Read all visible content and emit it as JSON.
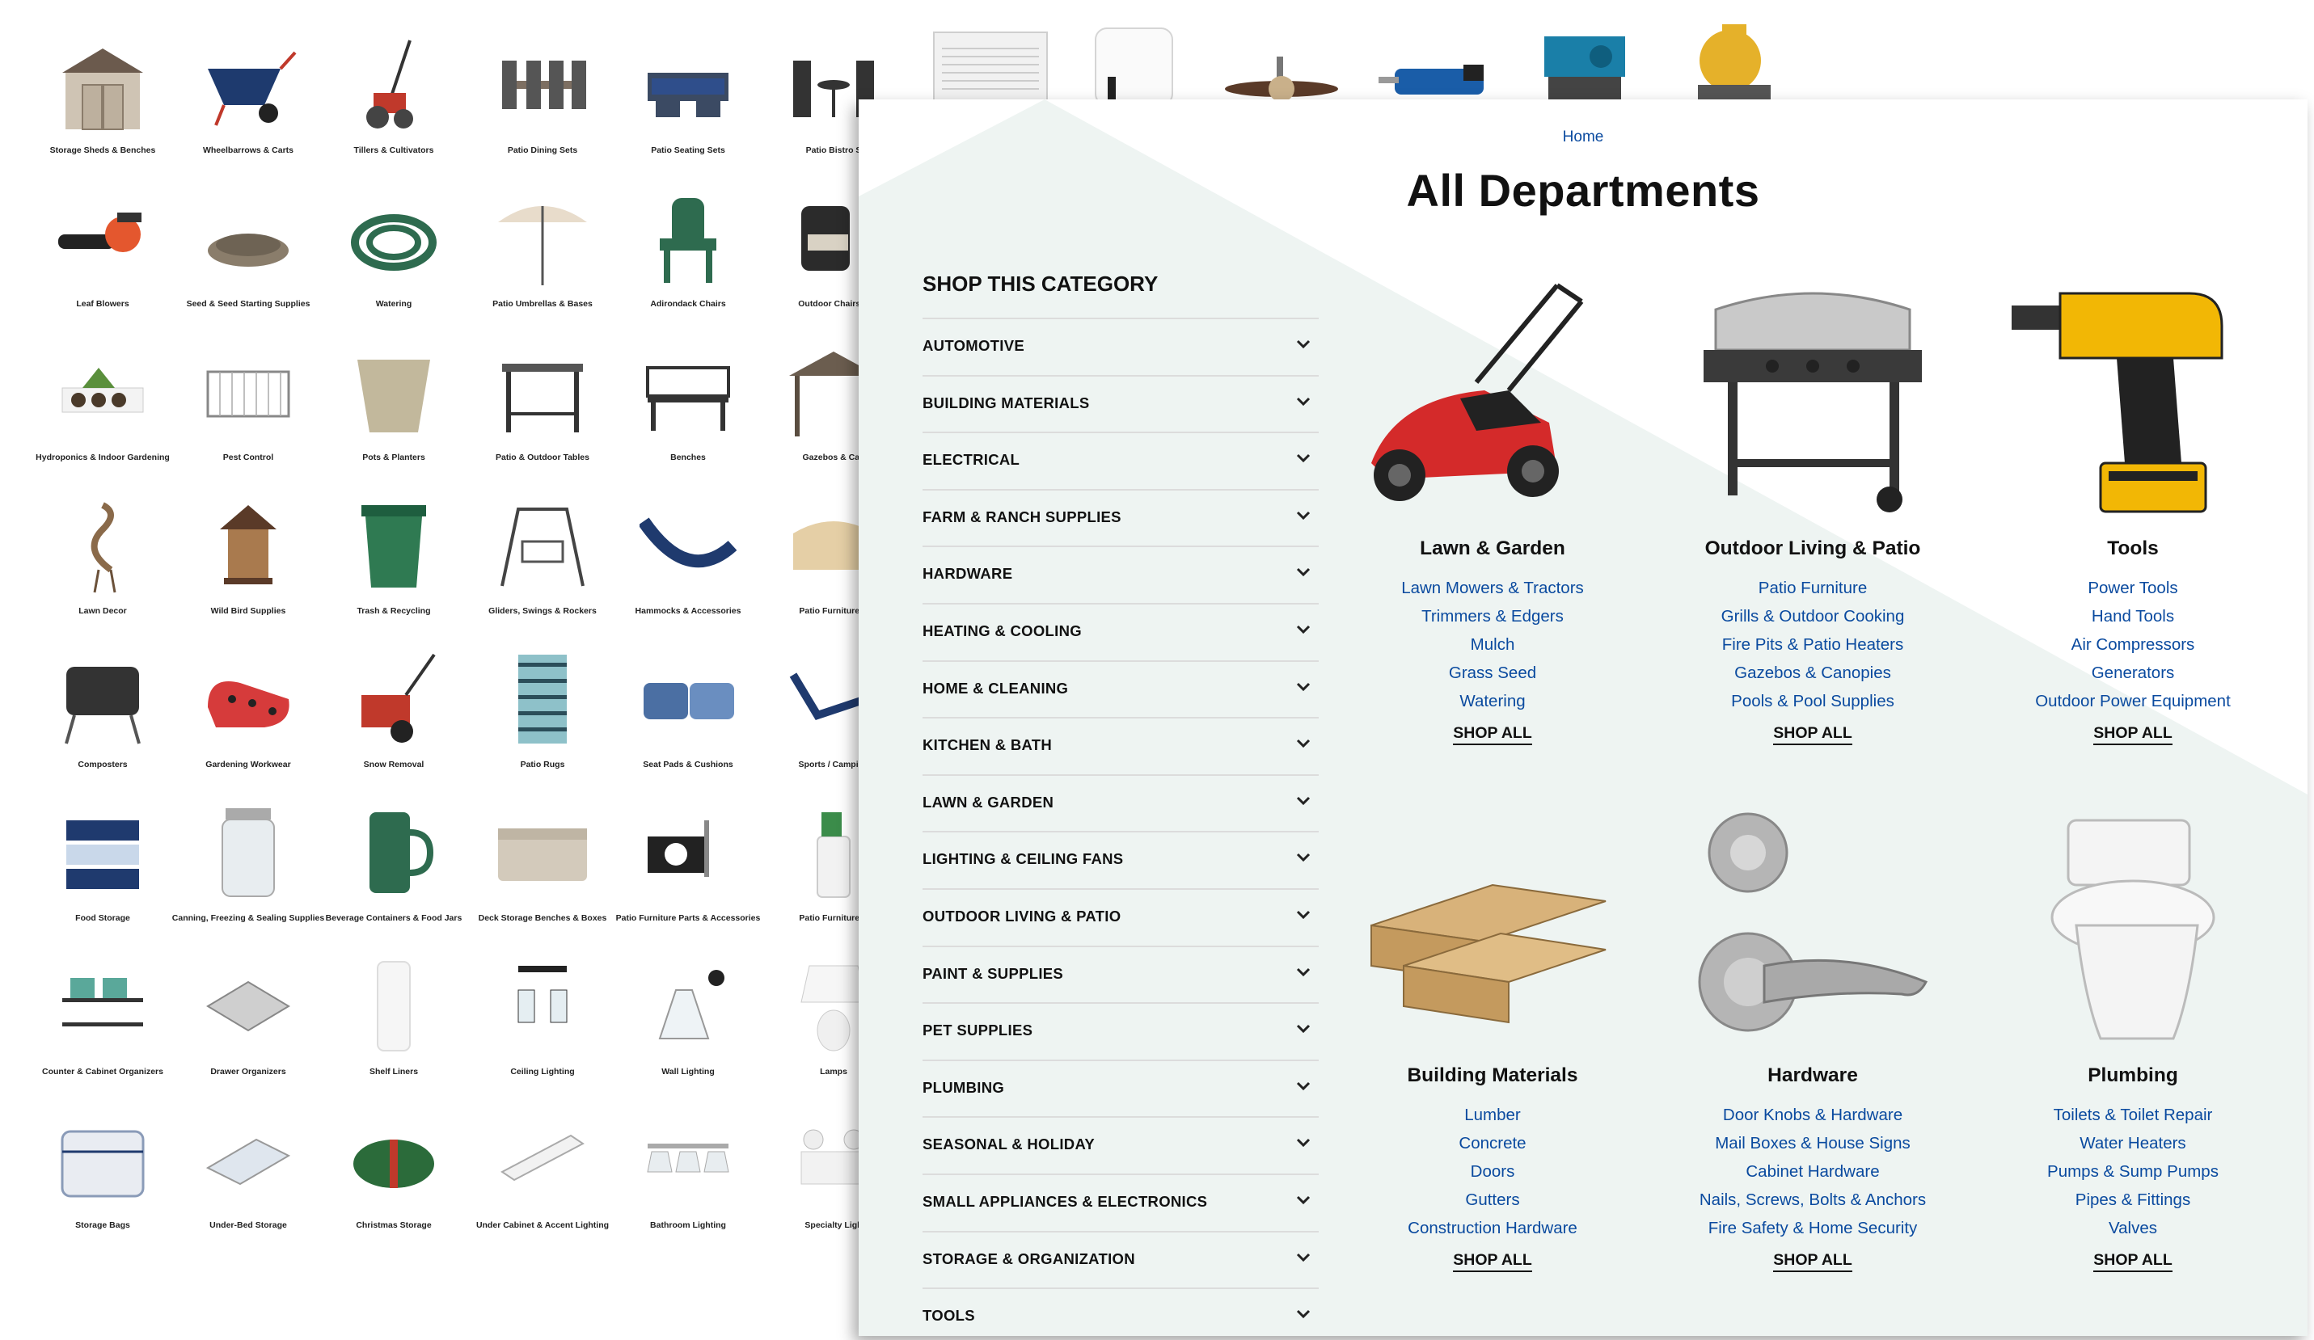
{
  "background": {
    "top_row_visible": [
      "air-conditioner",
      "air-purifier",
      "ceiling-fan",
      "reciprocating-saw",
      "jigsaw",
      "miter-saw"
    ],
    "grid": [
      [
        "Storage Sheds & Benches",
        "Wheelbarrows & Carts",
        "Tillers & Cultivators",
        "Patio Dining Sets",
        "Patio Seating Sets",
        "Patio Bistro S"
      ],
      [
        "Leaf Blowers",
        "Seed & Seed Starting Supplies",
        "Watering",
        "Patio Umbrellas & Bases",
        "Adirondack Chairs",
        "Outdoor Chairs &"
      ],
      [
        "Hydroponics & Indoor Gardening",
        "Pest Control",
        "Pots & Planters",
        "Patio & Outdoor Tables",
        "Benches",
        "Gazebos & Can"
      ],
      [
        "Lawn Decor",
        "Wild Bird Supplies",
        "Trash & Recycling",
        "Gliders, Swings & Rockers",
        "Hammocks & Accessories",
        "Patio Furniture C"
      ],
      [
        "Composters",
        "Gardening Workwear",
        "Snow Removal",
        "Patio Rugs",
        "Seat Pads & Cushions",
        "Sports / Camping"
      ],
      [
        "Food Storage",
        "Canning, Freezing & Sealing Supplies",
        "Beverage Containers & Food Jars",
        "Deck Storage Benches & Boxes",
        "Patio Furniture Parts & Accessories",
        "Patio Furniture C"
      ],
      [
        "Counter & Cabinet Organizers",
        "Drawer Organizers",
        "Shelf Liners",
        "Ceiling Lighting",
        "Wall Lighting",
        "Lamps"
      ],
      [
        "Storage Bags",
        "Under-Bed Storage",
        "Christmas Storage",
        "Under Cabinet & Accent Lighting",
        "Bathroom Lighting",
        "Specialty Ligh"
      ]
    ]
  },
  "panel": {
    "breadcrumb": "Home",
    "title": "All Departments",
    "sidebar_heading": "SHOP THIS CATEGORY",
    "categories": [
      "AUTOMOTIVE",
      "BUILDING MATERIALS",
      "ELECTRICAL",
      "FARM & RANCH SUPPLIES",
      "HARDWARE",
      "HEATING & COOLING",
      "HOME & CLEANING",
      "KITCHEN & BATH",
      "LAWN & GARDEN",
      "LIGHTING & CEILING FANS",
      "OUTDOOR LIVING & PATIO",
      "PAINT & SUPPLIES",
      "PET SUPPLIES",
      "PLUMBING",
      "SEASONAL & HOLIDAY",
      "SMALL APPLIANCES & ELECTRONICS",
      "STORAGE & ORGANIZATION",
      "TOOLS"
    ],
    "departments": [
      {
        "title": "Lawn & Garden",
        "image": "lawn-mower",
        "links": [
          "Lawn Mowers & Tractors",
          "Trimmers & Edgers",
          "Mulch",
          "Grass Seed",
          "Watering"
        ],
        "shop_all": "SHOP ALL"
      },
      {
        "title": "Outdoor Living & Patio",
        "image": "grill",
        "links": [
          "Patio Furniture",
          "Grills & Outdoor Cooking",
          "Fire Pits & Patio Heaters",
          "Gazebos & Canopies",
          "Pools & Pool Supplies"
        ],
        "shop_all": "SHOP ALL"
      },
      {
        "title": "Tools",
        "image": "drill",
        "links": [
          "Power Tools",
          "Hand Tools",
          "Air Compressors",
          "Generators",
          "Outdoor Power Equipment"
        ],
        "shop_all": "SHOP ALL"
      },
      {
        "title": "Building Materials",
        "image": "lumber",
        "links": [
          "Lumber",
          "Concrete",
          "Doors",
          "Gutters",
          "Construction Hardware"
        ],
        "shop_all": "SHOP ALL"
      },
      {
        "title": "Hardware",
        "image": "door-lock",
        "links": [
          "Door Knobs & Hardware",
          "Mail Boxes & House Signs",
          "Cabinet Hardware",
          "Nails, Screws, Bolts & Anchors",
          "Fire Safety & Home Security"
        ],
        "shop_all": "SHOP ALL"
      },
      {
        "title": "Plumbing",
        "image": "toilet",
        "links": [
          "Toilets & Toilet Repair",
          "Water Heaters",
          "Pumps & Sump Pumps",
          "Pipes & Fittings",
          "Valves"
        ],
        "shop_all": "SHOP ALL"
      }
    ]
  },
  "colors": {
    "link": "#0a4a9f",
    "text": "#111111",
    "accent_bg": "#eef4f2"
  }
}
